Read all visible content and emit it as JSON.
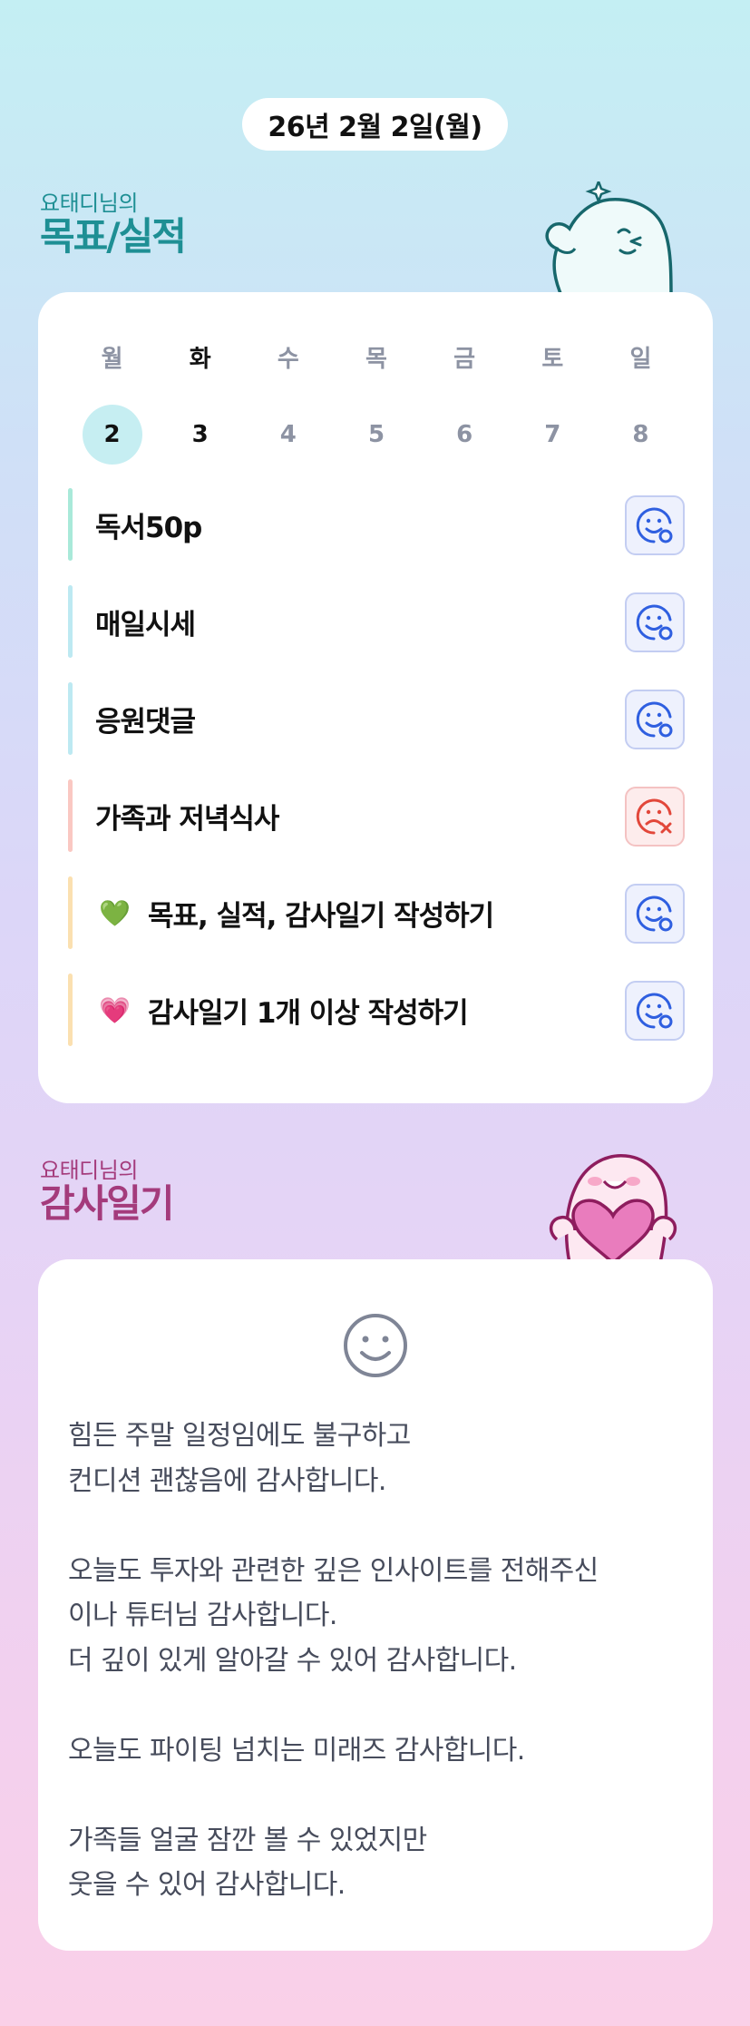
{
  "date": "26년 2월 2일(월)",
  "goal_section": {
    "subtitle": "요태디님의",
    "title": "목표/실적"
  },
  "week": {
    "days": [
      {
        "name": "월",
        "num": "2",
        "state": "today"
      },
      {
        "name": "화",
        "num": "3",
        "state": "bold"
      },
      {
        "name": "수",
        "num": "4",
        "state": "muted"
      },
      {
        "name": "목",
        "num": "5",
        "state": "muted"
      },
      {
        "name": "금",
        "num": "6",
        "state": "muted"
      },
      {
        "name": "토",
        "num": "7",
        "state": "muted"
      },
      {
        "name": "일",
        "num": "8",
        "state": "muted"
      }
    ]
  },
  "goals": [
    {
      "label": "독서50p",
      "bar_color": "#a9e9d9",
      "status": "done",
      "heart": ""
    },
    {
      "label": "매일시세",
      "bar_color": "#bde9f2",
      "status": "done",
      "heart": ""
    },
    {
      "label": "응원댓글",
      "bar_color": "#bde9f2",
      "status": "done",
      "heart": ""
    },
    {
      "label": "가족과 저녁식사",
      "bar_color": "#fac8c2",
      "status": "fail",
      "heart": ""
    },
    {
      "label": "목표, 실적, 감사일기 작성하기",
      "bar_color": "#fbe0b0",
      "status": "done",
      "heart": "💚"
    },
    {
      "label": "감사일기 1개 이상 작성하기",
      "bar_color": "#fbe0b0",
      "status": "done",
      "heart": "💗"
    }
  ],
  "gratitude_section": {
    "subtitle": "요태디님의",
    "title": "감사일기"
  },
  "gratitude_lines": [
    "힘든 주말 일정임에도 불구하고",
    "컨디션 괜찮음에 감사합니다.",
    "",
    "오늘도 투자와 관련한 깊은 인사이트를 전해주신",
    "이나 튜터님 감사합니다.",
    "더 깊이 있게 알아갈 수 있어 감사합니다.",
    "",
    "오늘도 파이팅 넘치는 미래즈 감사합니다.",
    "",
    "가족들 얼굴 잠깐 볼 수 있었지만",
    "웃을 수 있어 감사합니다."
  ],
  "colors": {
    "goal_heading": "#1e8f94",
    "gratitude_heading": "#a43b7c",
    "today_circle": "#c6eef2",
    "status_done": "#2f5fe0",
    "status_fail": "#e2473a"
  },
  "icons": {
    "status_done": "smile-check-icon",
    "status_fail": "frown-x-icon",
    "gratitude": "smile-face-icon"
  }
}
